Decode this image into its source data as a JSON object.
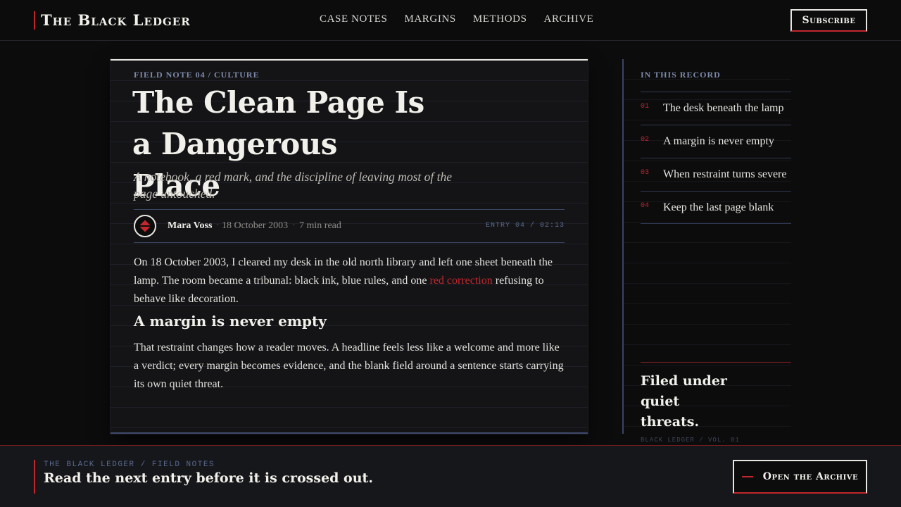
{
  "brand": {
    "name": "The Black Ledger"
  },
  "nav": {
    "items": [
      "CASE NOTES",
      "MARGINS",
      "METHODS",
      "ARCHIVE"
    ]
  },
  "header": {
    "subscribe_label": "Subscribe"
  },
  "article": {
    "kicker": "FIELD NOTE 04 / CULTURE",
    "headline": "The Clean Page Is a Dangerous Place",
    "dek": "A notebook, a red mark, and the discipline of leaving most of the page untouched.",
    "author": "Mara Voss",
    "date": "18 October 2003",
    "read_time": "7 min read",
    "entry": "ENTRY 04 / 02:13",
    "p1_before": "On 18 October 2003, I cleared my desk in the old north library and left one sheet beneath the lamp. The room became a tribunal: black ink, blue rules, and one ",
    "p1_link": "red correction",
    "p1_after": " refusing to behave like decoration.",
    "subhead": "A margin is never empty",
    "p2": "That restraint changes how a reader moves. A headline feels less like a welcome and more like a verdict; every margin becomes evidence, and the blank field around a sentence starts carrying its own quiet threat."
  },
  "record": {
    "title": "IN THIS RECORD",
    "items": [
      {
        "num": "01",
        "label": "The desk beneath the lamp"
      },
      {
        "num": "02",
        "label": "A margin is never empty"
      },
      {
        "num": "03",
        "label": "When restraint turns severe"
      },
      {
        "num": "04",
        "label": "Keep the last page blank"
      }
    ],
    "filed_text": "Filed under quiet threats.",
    "filed_sub": "BLACK LEDGER / VOL. 01"
  },
  "footer": {
    "kicker": "THE BLACK LEDGER / FIELD NOTES",
    "cta": "Read the next entry before it is crossed out.",
    "button_label": "Open the Archive"
  },
  "colors": {
    "accent": "#c1272d",
    "rule": "#3a4560",
    "background": "#0c0c0d",
    "paper": "#141417"
  }
}
